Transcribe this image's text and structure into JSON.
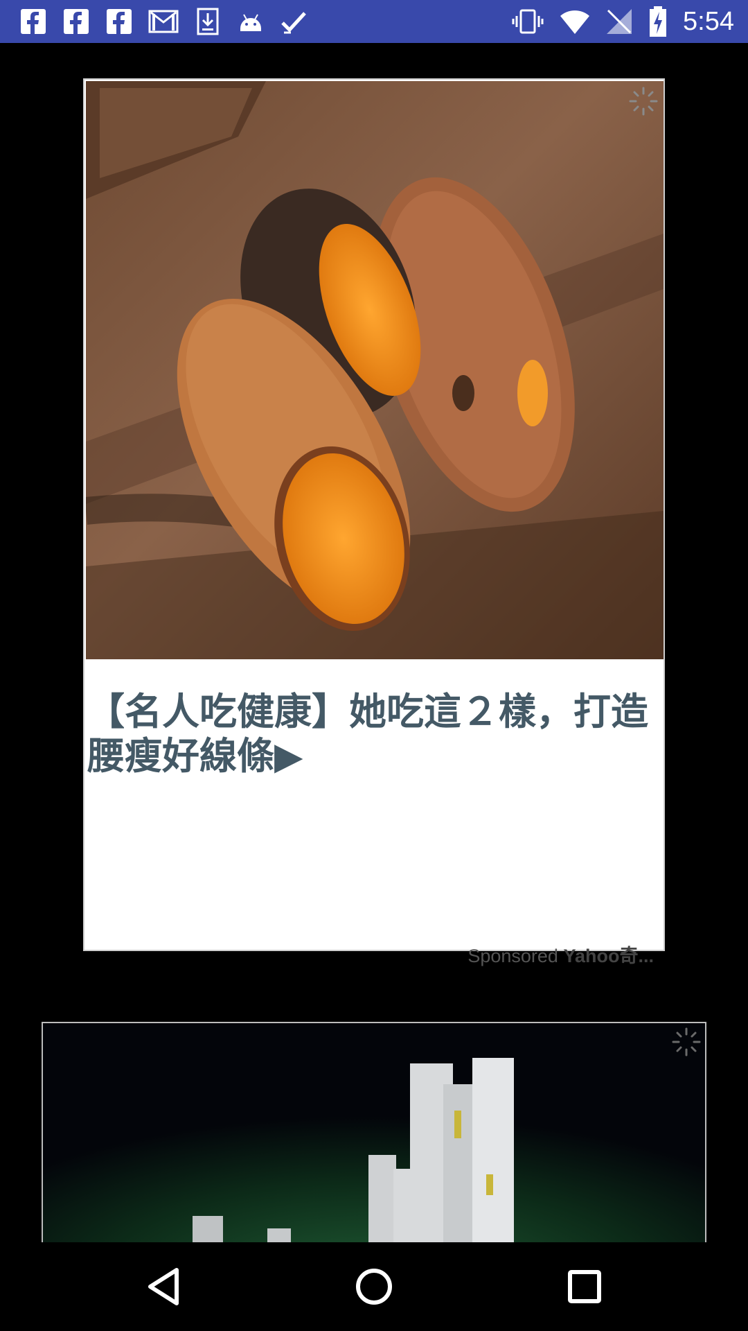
{
  "status_bar": {
    "time": "5:54",
    "left_icons": [
      "facebook-icon",
      "facebook-icon",
      "facebook-icon",
      "gmail-icon",
      "download-icon",
      "android-icon",
      "task-check-icon"
    ],
    "right_icons": [
      "vibrate-icon",
      "wifi-icon",
      "no-sim-icon",
      "battery-charging-icon"
    ],
    "background": "#3949ab"
  },
  "ad_1": {
    "image": "baked-sweet-potatoes-image",
    "headline": "【名人吃健康】她吃這２樣，打造腰瘦好線條▶",
    "sponsored_label": "Sponsored",
    "advertiser": "Yahoo奇...",
    "headline_color": "#445966"
  },
  "ad_2": {
    "image": "abb-drives-equipment-image"
  },
  "nav_bar": {
    "buttons": [
      "back-icon",
      "home-icon",
      "recents-icon"
    ]
  }
}
